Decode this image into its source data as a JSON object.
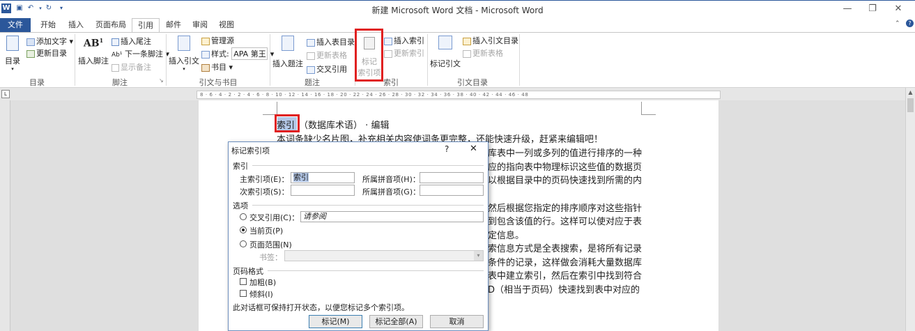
{
  "window": {
    "title": "新建 Microsoft Word 文档 - Microsoft Word",
    "controls": {
      "minimize": "—",
      "restore": "❐",
      "close": "✕"
    },
    "quick_access": [
      "save-icon",
      "undo-icon",
      "redo-icon",
      "customize-icon"
    ]
  },
  "tabs": {
    "file": "文件",
    "home": "开始",
    "insert": "插入",
    "layout": "页面布局",
    "references": "引用",
    "mailings": "邮件",
    "review": "审阅",
    "view": "视图"
  },
  "ribbon": {
    "toc": {
      "button": "目录",
      "add_text": "添加文字",
      "update": "更新目录",
      "group": "目录"
    },
    "footnote": {
      "insert_footnote": "插入脚注",
      "insert_endnote": "插入尾注",
      "next_footnote": "下一条脚注",
      "show_notes": "显示备注",
      "group": "脚注"
    },
    "citations": {
      "insert_citation": "插入引文",
      "manage_sources": "管理源",
      "style_label": "样式:",
      "style_value": "APA 第王",
      "bibliography": "书目",
      "group": "引文与书目"
    },
    "captions": {
      "insert_caption": "插入题注",
      "insert_table_of_figures": "插入表目录",
      "update_table": "更新表格",
      "cross_reference": "交叉引用",
      "group": "题注"
    },
    "index": {
      "mark_entry_line1": "标记",
      "mark_entry_line2": "索引项",
      "insert_index": "插入索引",
      "update_index": "更新索引",
      "group": "索引"
    },
    "authorities": {
      "mark_citation": "标记引文",
      "insert_table": "插入引文目录",
      "update_table": "更新表格",
      "group": "引文目录"
    }
  },
  "document": {
    "heading_selected": "索引",
    "heading_rest": "（数据库术语）",
    "heading_edit": "编辑",
    "lines": [
      "本词条缺少名片图，补充相关内容使词条更完整，还能快速升级，赶紧来编辑吧！"
    ],
    "right_lines": [
      "库表中一列或多列的值进行排序的一种",
      "应的指向表中物理标识这些值的数据页",
      "以根据目录中的页码快速找到所需的内",
      "",
      "然后根据您指定的排序顺序对这些指针",
      "到包含该值的行。这样可以使对应于表",
      "定信息。",
      "索信息方式是全表搜索，是将所有记录",
      "条件的记录，这样做会消耗大量数据库",
      "表中建立索引，然后在索引中找到符合",
      "D（相当于页码）快速找到表中对应的"
    ]
  },
  "dialog": {
    "title": "标记索引项",
    "help": "?",
    "close": "✕",
    "index_section": "索引",
    "main_entry_label": "主索引项(E)：",
    "main_entry_value": "索引",
    "main_pinyin_label": "所属拼音项(H)：",
    "main_pinyin_value": "",
    "sub_entry_label": "次索引项(S)：",
    "sub_entry_value": "",
    "sub_pinyin_label": "所属拼音项(G)：",
    "sub_pinyin_value": "",
    "options_section": "选项",
    "cross_ref_label": "交叉引用(C)：",
    "cross_ref_value": "请参阅",
    "current_page_label": "当前页(P)",
    "page_range_label": "页面范围(N)",
    "bookmark_label": "书签：",
    "bookmark_value": "",
    "selected_option": "current_page",
    "format_section": "页码格式",
    "bold_label": "加粗(B)",
    "italic_label": "倾斜(I)",
    "note": "此对话框可保持打开状态，以便您标记多个索引项。",
    "mark_button": "标记(M)",
    "mark_all_button": "标记全部(A)",
    "cancel_button": "取消"
  },
  "ruler": {
    "ticks": "8 · 6 · 4 · 2 · 2 · 4 · 6 · 8 · 10 · 12 · 14 · 16 · 18 · 20 · 22 · 24 · 26 · 28 · 30 · 32 · 34 · 36 · 38 · 40 · 42 · 44 · 46 · 48"
  },
  "colors": {
    "accent": "#2b579a",
    "highlight": "#e02020",
    "selection": "#b4c8e8"
  }
}
